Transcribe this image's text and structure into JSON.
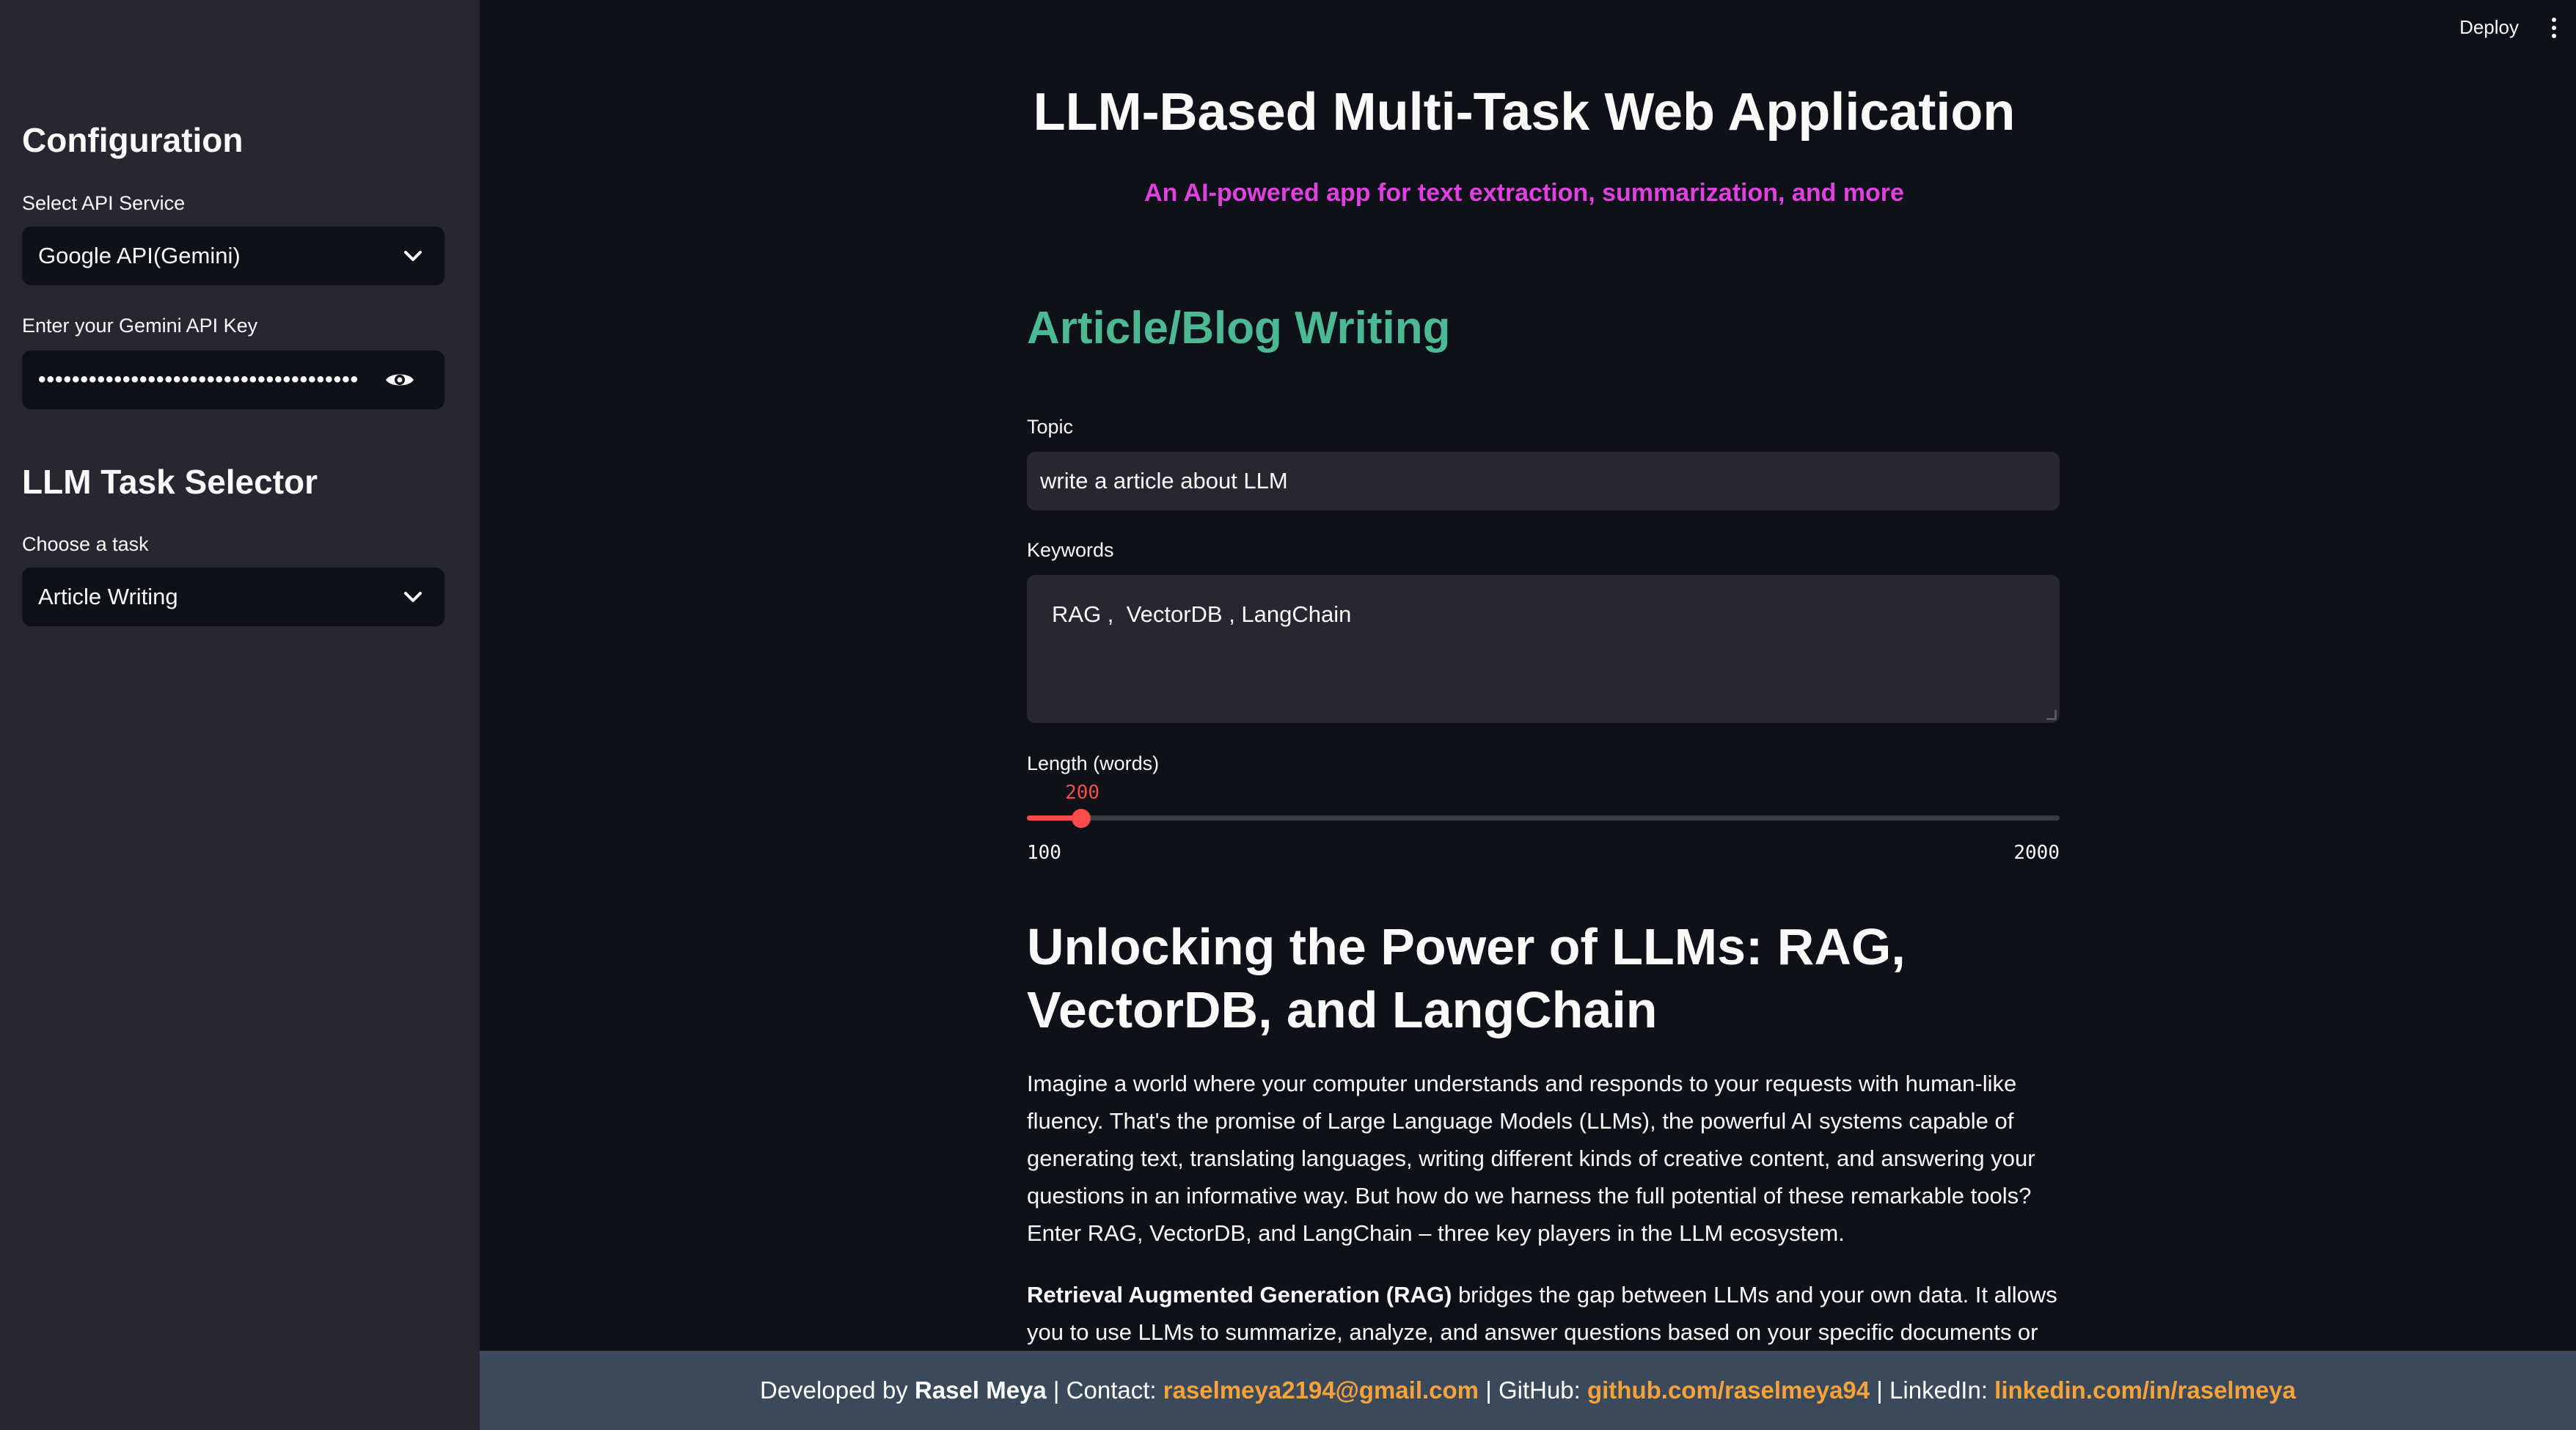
{
  "header": {
    "deploy_label": "Deploy"
  },
  "sidebar": {
    "config_heading": "Configuration",
    "api_service_label": "Select API Service",
    "api_service_value": "Google API(Gemini)",
    "api_key_label": "Enter your Gemini API Key",
    "api_key_masked": "••••••••••••••••••••••••••••••••••••••",
    "task_heading": "LLM Task Selector",
    "task_label": "Choose a task",
    "task_value": "Article Writing"
  },
  "main": {
    "title": "LLM-Based Multi-Task Web Application",
    "subtitle": "An AI-powered app for text extraction, summarization, and more",
    "section_heading": "Article/Blog Writing",
    "topic_label": "Topic",
    "topic_value": "write a article about LLM",
    "keywords_label": "Keywords",
    "keywords_value": "RAG ,  VectorDB , LangChain",
    "length_label": "Length (words)",
    "slider": {
      "value": 200,
      "min": 100,
      "max": 2000,
      "value_text": "200",
      "min_text": "100",
      "max_text": "2000"
    },
    "article_title": "Unlocking the Power of LLMs: RAG, VectorDB, and LangChain",
    "paragraph1": "Imagine a world where your computer understands and responds to your requests with human-like fluency. That's the promise of Large Language Models (LLMs), the powerful AI systems capable of generating text, translating languages, writing different kinds of creative content, and answering your questions in an informative way. But how do we harness the full potential of these remarkable tools? Enter RAG, VectorDB, and LangChain – three key players in the LLM ecosystem.",
    "paragraph2_bold": "Retrieval Augmented Generation (RAG)",
    "paragraph2_rest": " bridges the gap between LLMs and your own data. It allows you to use LLMs to summarize, analyze, and answer questions based on your specific documents or"
  },
  "footer": {
    "developed_by": "Developed by ",
    "name": "Rasel Meya",
    "contact_label": " | Contact: ",
    "email": "raselmeya2194@gmail.com",
    "github_label": " | GitHub: ",
    "github": "github.com/raselmeya94",
    "linkedin_label": " | LinkedIn: ",
    "linkedin": "linkedin.com/in/raselmeya"
  },
  "colors": {
    "background": "#0e1117",
    "sidebar": "#262730",
    "accent_red": "#ff4b4b",
    "subtitle_magenta": "#e040e0",
    "section_green": "#4db894",
    "footer_bg": "#3a4a5a",
    "footer_link": "#f7a23b"
  },
  "icons": [
    "chevron-down-icon",
    "eye-icon",
    "more-vert-icon"
  ]
}
